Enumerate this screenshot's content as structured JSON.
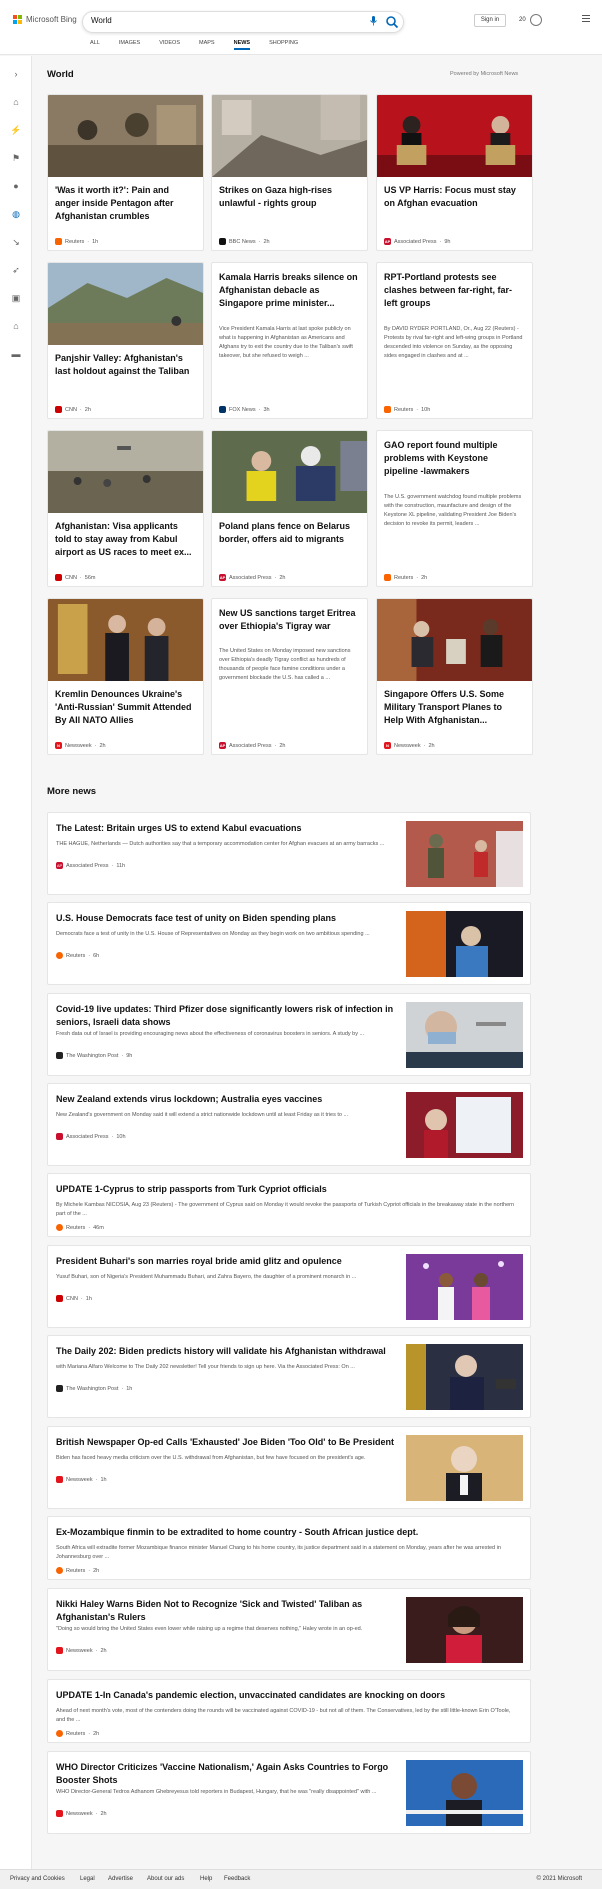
{
  "header": {
    "brand": "Microsoft Bing",
    "query": "World",
    "tabs": [
      "ALL",
      "IMAGES",
      "VIDEOS",
      "MAPS",
      "NEWS",
      "SHOPPING"
    ],
    "signin": "Sign in",
    "points": "20"
  },
  "world": {
    "title": "World",
    "powered": "Powered by Microsoft News",
    "cards": [
      {
        "title": "'Was it worth it?': Pain and anger inside Pentagon after Afghanistan crumbles",
        "source": "Reuters",
        "time": "1h",
        "desc": ""
      },
      {
        "title": "Strikes on Gaza high-rises unlawful - rights group",
        "source": "BBC News",
        "time": "2h",
        "desc": ""
      },
      {
        "title": "US VP Harris: Focus must stay on Afghan evacuation",
        "source": "Associated Press",
        "time": "9h",
        "desc": ""
      },
      {
        "title": "Panjshir Valley: Afghanistan's last holdout against the Taliban",
        "source": "CNN",
        "time": "2h",
        "desc": ""
      },
      {
        "title": "Kamala Harris breaks silence on Afghanistan debacle as Singapore prime minister...",
        "source": "FOX News",
        "time": "3h",
        "desc": "Vice President Kamala Harris at last spoke publicly on what is happening in Afghanistan as Americans and Afghans try to exit the country due to the Taliban's swift takeover, but she refused to weigh ..."
      },
      {
        "title": "RPT-Portland protests see clashes between far-right, far-left groups",
        "source": "Reuters",
        "time": "10h",
        "desc": "By DAVID RYDER PORTLAND, Or., Aug 22 (Reuters) - Protests by rival far-right and left-wing groups in Portland descended into violence on Sunday, as the opposing sides engaged in clashes and at ..."
      },
      {
        "title": "Afghanistan: Visa applicants told to stay away from Kabul airport as US races to meet ex...",
        "source": "CNN",
        "time": "56m",
        "desc": ""
      },
      {
        "title": "Poland plans fence on Belarus border, offers aid to migrants",
        "source": "Associated Press",
        "time": "2h",
        "desc": ""
      },
      {
        "title": "GAO report found multiple problems with Keystone pipeline -lawmakers",
        "source": "Reuters",
        "time": "2h",
        "desc": "The U.S. government watchdog found multiple problems with the construction, maunfacture and design of the Keystone XL pipeline, validating President Joe Biden's decision to revoke its permit, leaders ..."
      },
      {
        "title": "Kremlin Denounces Ukraine's 'Anti-Russian' Summit Attended By All NATO Allies",
        "source": "Newsweek",
        "time": "2h",
        "desc": ""
      },
      {
        "title": "New US sanctions target Eritrea over Ethiopia's Tigray war",
        "source": "Associated Press",
        "time": "2h",
        "desc": "The United States on Monday imposed new sanctions over Ethiopia's deadly Tigray conflict as hundreds of thousands of people face famine conditions under a government blockade the U.S. has called a ..."
      },
      {
        "title": "Singapore Offers U.S. Some Military Transport Planes to Help With Afghanistan...",
        "source": "Newsweek",
        "time": "2h",
        "desc": ""
      }
    ]
  },
  "more": {
    "title": "More news",
    "items": [
      {
        "title": "The Latest: Britain urges US to extend Kabul evacuations",
        "desc": "THE HAGUE, Netherlands — Dutch authorities say that a temporary accommodation center for Afghan evacues at an army barracks ...",
        "source": "Associated Press",
        "time": "11h"
      },
      {
        "title": "U.S. House Democrats face test of unity on Biden spending plans",
        "desc": "Democrats face a test of unity in the U.S. House of Representatives on Monday as they begin work on two ambitious spending ...",
        "source": "Reuters",
        "time": "6h"
      },
      {
        "title": "Covid-19 live updates: Third Pfizer dose significantly lowers risk of infection in seniors, Israeli data shows",
        "desc": "Fresh data out of Israel is providing encouraging news about the effectiveness of coronavirus boosters in seniors. A study by ...",
        "source": "The Washington Post",
        "time": "9h"
      },
      {
        "title": "New Zealand extends virus lockdown; Australia eyes vaccines",
        "desc": "New Zealand's government on Monday said it will extend a strict nationwide lockdown until at least Friday as it tries to ...",
        "source": "Associated Press",
        "time": "10h"
      },
      {
        "title": "UPDATE 1-Cyprus to strip passports from Turk Cypriot officials",
        "desc": "By Michele Kambas NICOSIA, Aug 23 (Reuters) - The government of Cyprus said on Monday it would revoke the passports of Turkish Cypriot officials in the breakaway state in the northern part of the ...",
        "source": "Reuters",
        "time": "46m"
      },
      {
        "title": "President Buhari's son marries royal bride amid glitz and opulence",
        "desc": "Yusuf Buhari, son of Nigeria's President Muhammadu Buhari, and Zahra Bayero, the daughter of a prominent monarch in ...",
        "source": "CNN",
        "time": "1h"
      },
      {
        "title": "The Daily 202: Biden predicts history will validate his Afghanistan withdrawal",
        "desc": "with Mariana Alfaro Welcome to The Daily 202 newsletter! Tell your friends to sign up here. Via the Associated Press: On ...",
        "source": "The Washington Post",
        "time": "1h"
      },
      {
        "title": "British Newspaper Op-ed Calls 'Exhausted' Joe Biden 'Too Old' to Be President",
        "desc": "Biden has faced heavy media criticism over the U.S. withdrawal from Afghanistan, but few have focused on the president's age.",
        "source": "Newsweek",
        "time": "1h"
      },
      {
        "title": "Ex-Mozambique finmin to be extradited to home country - South African justice dept.",
        "desc": "South Africa will extradite former Mozambique finance minister Manuel Chang to his home country, its justice department said in a statement on Monday, years after he was arrested in Johannesburg over ...",
        "source": "Reuters",
        "time": "2h"
      },
      {
        "title": "Nikki Haley Warns Biden Not to Recognize 'Sick and Twisted' Taliban as Afghanistan's Rulers",
        "desc": "\"Doing so would bring the United States even lower while raising up a regime that deserves nothing,\" Haley wrote in an op-ed.",
        "source": "Newsweek",
        "time": "2h"
      },
      {
        "title": "UPDATE 1-In Canada's pandemic election, unvaccinated candidates are knocking on doors",
        "desc": "Ahead of next month's vote, most of the contenders doing the rounds will be vaccinated against COVID-19 - but not all of them. The Conservatives, led by the still little-known Erin O'Toole, and the ...",
        "source": "Reuters",
        "time": "2h"
      },
      {
        "title": "WHO Director Criticizes 'Vaccine Nationalism,' Again Asks Countries to Forgo Booster Shots",
        "desc": "WHO Director-General Tedros Adhanom Ghebreyesus told reporters in Budapest, Hungary, that he was \"really disappointed\" with ...",
        "source": "Newsweek",
        "time": "2h"
      }
    ]
  },
  "footer": {
    "links": [
      "Privacy and Cookies",
      "Legal",
      "Advertise",
      "About our ads",
      "Help",
      "Feedback"
    ],
    "copyright": "© 2021 Microsoft"
  },
  "colors": {
    "accent": "#0067b8",
    "reuters": "#fa6400",
    "cnn": "#cc0000",
    "newsweek": "#e3141b",
    "ap": "#c8102e",
    "bbc": "#111111",
    "fox": "#003366",
    "wapo": "#222222"
  }
}
